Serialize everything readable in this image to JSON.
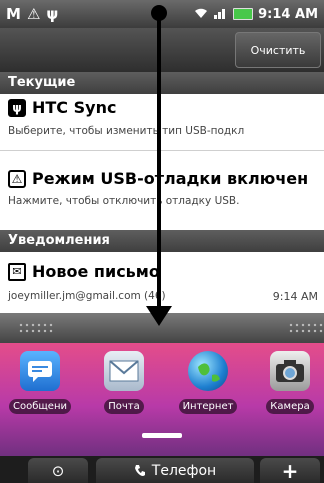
{
  "status_bar": {
    "icons": [
      "gmail-icon",
      "warning-icon",
      "usb-icon"
    ],
    "gmail_glyph": "M",
    "warning_glyph": "⚠",
    "usb_glyph": "ψ",
    "time": "9:14 AM"
  },
  "panel": {
    "clear_label": "Очистить",
    "current_header": "Текущие",
    "notifications_header": "Уведомления",
    "items": [
      {
        "icon": "usb-icon",
        "title": "HTC Sync",
        "subtitle": "Выберите, чтобы изменить тип USB-подкл"
      },
      {
        "icon": "warning-icon",
        "title": "Режим USB-отладки включен",
        "subtitle": "Нажмите, чтобы отключить отладку USB."
      },
      {
        "icon": "mail-icon",
        "title": "Новое письмо",
        "subtitle": "joeymiller.jm@gmail.com (46)",
        "time": "9:14 AM"
      }
    ]
  },
  "home": {
    "apps": [
      {
        "icon": "messages-icon",
        "label": "Сообщени"
      },
      {
        "icon": "mail-app-icon",
        "label": "Почта"
      },
      {
        "icon": "globe-icon",
        "label": "Интернет"
      },
      {
        "icon": "camera-icon",
        "label": "Камера"
      }
    ]
  },
  "dock": {
    "left_glyph": "⊙",
    "phone_label": "Телефон",
    "plus_glyph": "+"
  },
  "colors": {
    "status_bar": "#4a4a4a",
    "battery": "#48c84a",
    "wallpaper_top": "#e44d8a",
    "wallpaper_bottom": "#4a2a6a"
  }
}
